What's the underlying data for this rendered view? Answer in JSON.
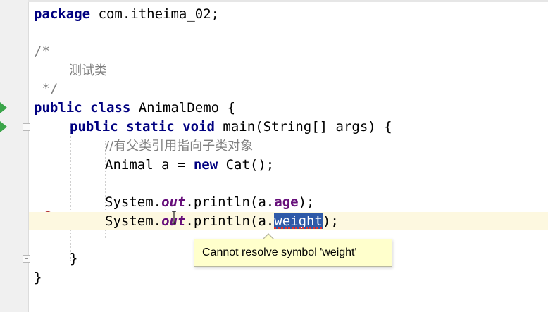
{
  "editor": {
    "language": "Java",
    "lines": {
      "l1": {
        "kw": "package",
        "rest": " com.itheima_02;"
      },
      "l3": {
        "text": "/*"
      },
      "l4": {
        "text": "测试类"
      },
      "l5": {
        "text": " */"
      },
      "l6": {
        "kw1": "public",
        "kw2": "class",
        "rest": " AnimalDemo {"
      },
      "l7": {
        "kw1": "public",
        "kw2": "static",
        "kw3": "void",
        "rest": " main(String[] args) {"
      },
      "l8": {
        "text": "//有父类引用指向子类对象"
      },
      "l9": {
        "pre": "Animal a = ",
        "kw": "new",
        "post": " Cat();"
      },
      "l11": {
        "pre": "System.",
        "static_field": "out",
        "mid": ".println(a.",
        "field": "age",
        "post": ");"
      },
      "l12": {
        "pre": "System.",
        "static_field": "out",
        "mid": ".println(a.",
        "error_symbol": "weight",
        "post": ");"
      },
      "l14": {
        "text": "}"
      },
      "l15": {
        "text": "}"
      }
    }
  },
  "tooltip": {
    "text": "Cannot resolve symbol 'weight'"
  },
  "icons": {
    "run_arrow": "run-icon",
    "fold": "fold-icon",
    "error_bulb": "error-bulb-icon"
  },
  "colors": {
    "keyword": "#000080",
    "comment": "#808080",
    "field": "#660e7a",
    "selection": "#2f5aa8",
    "current_line": "#fdf8e0",
    "tooltip_bg": "#ffffcc",
    "run_arrow": "#3ba54a"
  }
}
